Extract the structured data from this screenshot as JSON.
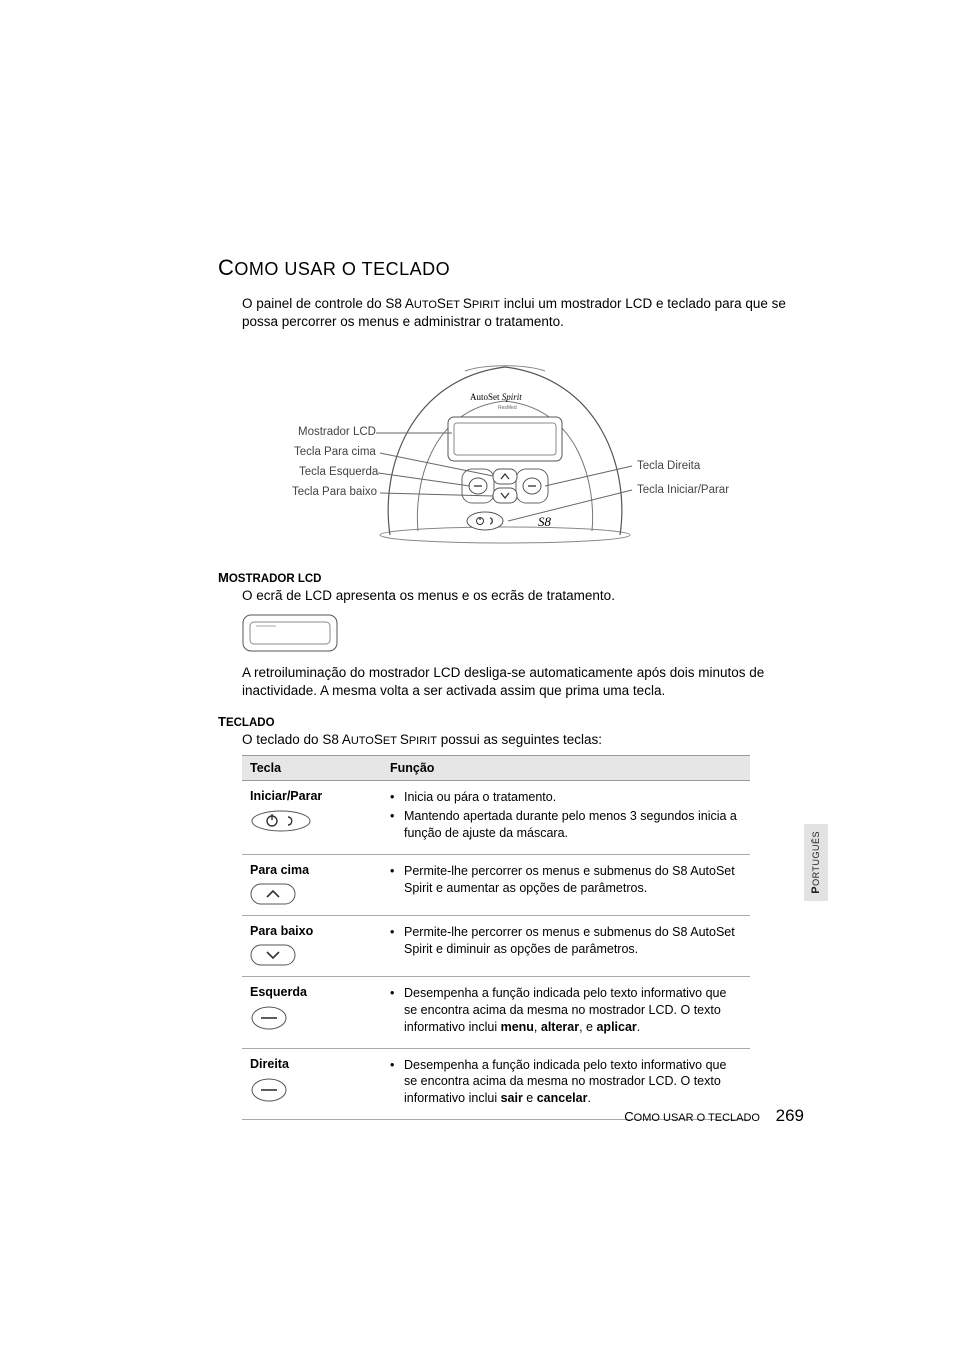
{
  "heading": {
    "big": "C",
    "rest": "OMO USAR O TECLADO"
  },
  "intro": {
    "p1a": "O painel de controle do ",
    "prod": "S8 A",
    "prod_sc": "UTO",
    "prod2": "S",
    "prod2_sc": "ET ",
    "prod3": "S",
    "prod3_sc": "PIRIT",
    "p1b": " inclui um mostrador LCD e teclado para que se possa percorrer os menus e administrar o tratamento."
  },
  "diagram": {
    "brand": "AutoSet Spirit",
    "sub": "ResMed",
    "labels": {
      "lcd": "Mostrador LCD",
      "up": "Tecla Para cima",
      "left": "Tecla Esquerda",
      "down": "Tecla Para baixo",
      "right": "Tecla Direita",
      "start": "Tecla Iniciar/Parar"
    }
  },
  "sec1": {
    "h_big": "M",
    "h_rest": "OSTRADOR LCD",
    "p1": "O ecrã de LCD apresenta os menus e os ecrãs de tratamento.",
    "p2": "A retroiluminação do mostrador LCD desliga-se automaticamente após dois minutos de inactividade. A mesma volta a ser activada assim que prima uma tecla."
  },
  "sec2": {
    "h_big": "T",
    "h_rest": "ECLADO",
    "p1a": "O teclado do ",
    "p1b": " possui as seguintes teclas:"
  },
  "table": {
    "headers": {
      "key": "Tecla",
      "func": "Função"
    },
    "rows": [
      {
        "key": "Iniciar/Parar",
        "items": [
          "Inicia ou pára o tratamento.",
          "Mantendo apertada durante pelo menos 3 segundos inicia a função de ajuste da máscara."
        ]
      },
      {
        "key": "Para cima",
        "items": [
          "Permite-lhe percorrer os menus e submenus do S8 AutoSet Spirit e aumentar as opções de parâmetros."
        ]
      },
      {
        "key": "Para baixo",
        "items": [
          "Permite-lhe percorrer os menus e submenus do S8 AutoSet Spirit e diminuir as opções de parâmetros."
        ]
      },
      {
        "key": "Esquerda",
        "items_html": "Desempenha a função indicada pelo texto informativo que se encontra acima da mesma no mostrador LCD. O texto informativo inclui <b>menu</b>, <b>alterar</b>, e <b>aplicar</b>."
      },
      {
        "key": "Direita",
        "items_html": "Desempenha a função indicada pelo texto informativo que se encontra acima da mesma no mostrador LCD. O texto informativo inclui <b>sair</b> e <b>cancelar</b>."
      }
    ]
  },
  "sidetab": {
    "big": "P",
    "rest": "ORTUGUÊS"
  },
  "footer": {
    "big": "C",
    "rest": "OMO USAR O TECLADO",
    "page": "269"
  }
}
